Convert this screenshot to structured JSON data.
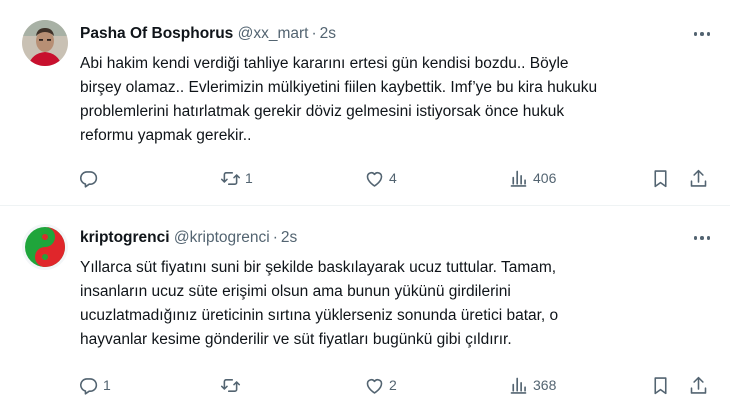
{
  "tweets": [
    {
      "author_name": "Pasha Of Bosphorus",
      "handle": "@xx_mart",
      "time": "2s",
      "lines": [
        "Abi hakim kendi verdiği tahliye kararını ertesi gün kendisi bozdu.. Böyle",
        "birşey olamaz.. Evlerimizin mülkiyetini fiilen kaybettik. Imf’ye bu kira hukuku",
        "problemlerini hatırlatmak gerekir döviz gelmesini istiyorsak önce hukuk",
        "reformu yapmak gerekir.."
      ],
      "replies": "",
      "retweets": "1",
      "likes": "4",
      "views": "406",
      "avatar_colors": {
        "bg": "#c9c1b4",
        "face": "#b78f74",
        "shirt": "#c8102e"
      }
    },
    {
      "author_name": "kriptogrenci",
      "handle": "@kriptogrenci",
      "time": "2s",
      "lines": [
        "Yıllarca süt fiyatını suni bir şekilde baskılayarak ucuz tuttular. Tamam,",
        "insanların ucuz süte erişimi olsun ama bunun yükünü girdilerini",
        "ucuzlatmadığınız üreticinin sırtına yüklerseniz sonunda üretici batar, o",
        "hayvanlar kesime gönderilir ve süt fiyatları bugünkü gibi çıldırır."
      ],
      "replies": "1",
      "retweets": "",
      "likes": "2",
      "views": "368",
      "avatar_colors": {
        "red": "#e0262b",
        "green": "#1fa53b",
        "bg": "#f3f6f8"
      }
    }
  ],
  "icons": [
    "reply-icon",
    "retweet-icon",
    "like-icon",
    "views-icon",
    "bookmark-icon",
    "share-icon",
    "more-icon"
  ],
  "colors": {
    "text": "#0f1419",
    "secondary": "#536471",
    "divider": "#eff3f4"
  }
}
